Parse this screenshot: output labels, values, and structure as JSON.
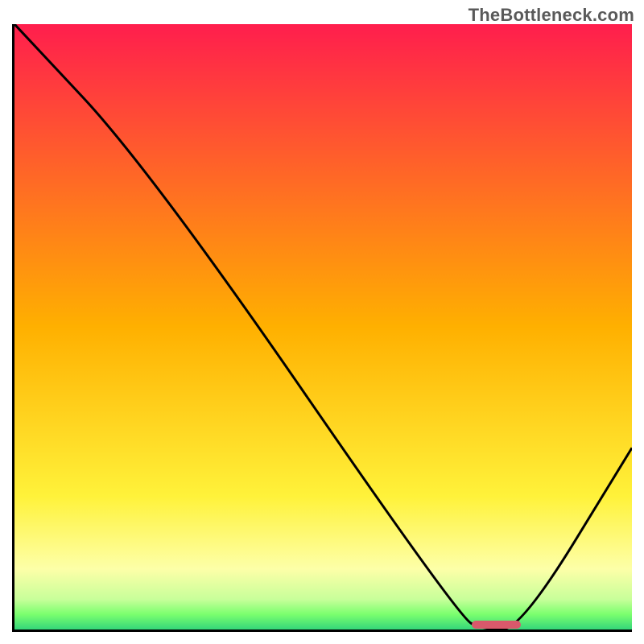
{
  "watermark": "TheBottleneck.com",
  "chart_data": {
    "type": "line",
    "title": "",
    "xlabel": "",
    "ylabel": "",
    "xlim": [
      0,
      100
    ],
    "ylim": [
      0,
      100
    ],
    "grid": false,
    "series": [
      {
        "name": "bottleneck-curve",
        "x": [
          0,
          22,
          72,
          76,
          82,
          100
        ],
        "values": [
          100,
          76,
          2,
          0,
          0,
          30
        ]
      }
    ],
    "marker": {
      "x_start": 74,
      "x_end": 82,
      "y": 0,
      "color": "#d9596b"
    },
    "background_gradient": {
      "stops": [
        {
          "offset": 0.0,
          "color": "#ff1e4d"
        },
        {
          "offset": 0.5,
          "color": "#ffb000"
        },
        {
          "offset": 0.78,
          "color": "#fff23a"
        },
        {
          "offset": 0.9,
          "color": "#fdffa8"
        },
        {
          "offset": 0.95,
          "color": "#c8ff9a"
        },
        {
          "offset": 0.975,
          "color": "#7aff6e"
        },
        {
          "offset": 1.0,
          "color": "#34d67a"
        }
      ]
    }
  }
}
